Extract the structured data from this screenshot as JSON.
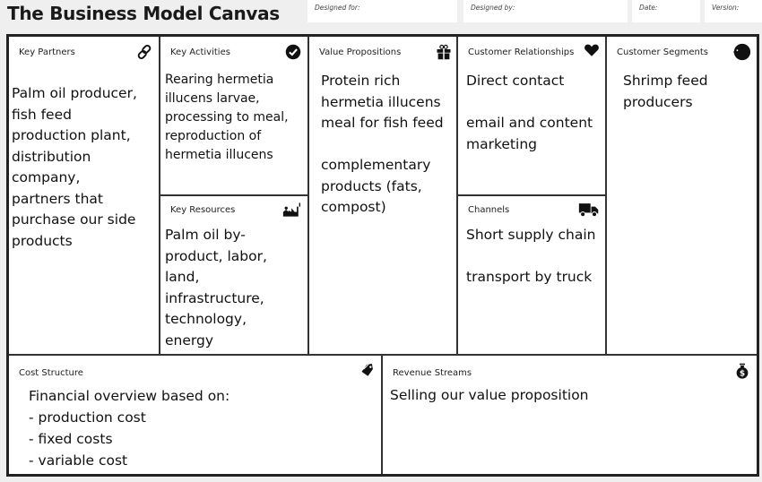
{
  "header": {
    "title": "The Business Model Canvas",
    "designed_for_label": "Designed for:",
    "designed_by_label": "Designed by:",
    "date_label": "Date:",
    "version_label": "Version:"
  },
  "blocks": {
    "key_partners": {
      "label": "Key Partners",
      "icon": "link-icon",
      "content": "Palm oil producer,\nfish feed\nproduction plant,\ndistribution\ncompany,\npartners that\npurchase our side\nproducts"
    },
    "key_activities": {
      "label": "Key Activities",
      "icon": "checkmark-icon",
      "content": "Rearing hermetia\nillucens larvae,\nprocessing to meal,\nreproduction of\nhermetia illucens"
    },
    "key_resources": {
      "label": "Key Resources",
      "icon": "factory-icon",
      "content": "Palm oil by-\nproduct, labor,\nland,\ninfrastructure,\ntechnology,\nenergy"
    },
    "value_propositions": {
      "label": "Value Propositions",
      "icon": "gift-icon",
      "content": "Protein rich\nhermetia illucens\nmeal for fish feed\n\ncomplementary\nproducts (fats,\ncompost)"
    },
    "customer_relationships": {
      "label": "Customer Relationships",
      "icon": "heart-icon",
      "content": "Direct contact\n\nemail and content\nmarketing"
    },
    "channels": {
      "label": "Channels",
      "icon": "truck-icon",
      "content": "Short supply chain\n\ntransport by truck"
    },
    "customer_segments": {
      "label": "Customer Segments",
      "icon": "head-icon",
      "content": "Shrimp feed\nproducers"
    },
    "cost_structure": {
      "label": "Cost Structure",
      "icon": "price-tag-icon",
      "content": "Financial overview based on:\n- production cost\n- fixed costs\n- variable cost"
    },
    "revenue_streams": {
      "label": "Revenue Streams",
      "icon": "money-bag-icon",
      "content": "Selling our value proposition"
    }
  }
}
